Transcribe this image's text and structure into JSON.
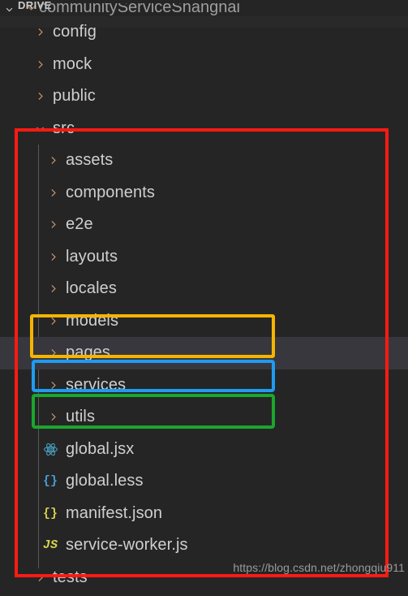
{
  "window": {
    "background": "#252526",
    "selected_row_background": "#37373d"
  },
  "section_header": {
    "title": "DRIVE",
    "twisty": "chevron-down-icon"
  },
  "tree": {
    "root": {
      "label": "communityServiceShanghai",
      "expanded": true
    },
    "items": [
      {
        "label": "config",
        "type": "folder",
        "depth": 1,
        "expanded": false,
        "icon": "chevron-right-icon"
      },
      {
        "label": "mock",
        "type": "folder",
        "depth": 1,
        "expanded": false,
        "icon": "chevron-right-icon"
      },
      {
        "label": "public",
        "type": "folder",
        "depth": 1,
        "expanded": false,
        "icon": "chevron-right-icon"
      },
      {
        "label": "src",
        "type": "folder",
        "depth": 1,
        "expanded": true,
        "icon": "chevron-down-icon"
      },
      {
        "label": "assets",
        "type": "folder",
        "depth": 2,
        "expanded": false,
        "icon": "chevron-right-icon"
      },
      {
        "label": "components",
        "type": "folder",
        "depth": 2,
        "expanded": false,
        "icon": "chevron-right-icon"
      },
      {
        "label": "e2e",
        "type": "folder",
        "depth": 2,
        "expanded": false,
        "icon": "chevron-right-icon"
      },
      {
        "label": "layouts",
        "type": "folder",
        "depth": 2,
        "expanded": false,
        "icon": "chevron-right-icon"
      },
      {
        "label": "locales",
        "type": "folder",
        "depth": 2,
        "expanded": false,
        "icon": "chevron-right-icon"
      },
      {
        "label": "models",
        "type": "folder",
        "depth": 2,
        "expanded": false,
        "icon": "chevron-right-icon",
        "highlight": "orange"
      },
      {
        "label": "pages",
        "type": "folder",
        "depth": 2,
        "expanded": false,
        "icon": "chevron-right-icon",
        "highlight": "blue",
        "selected": true
      },
      {
        "label": "services",
        "type": "folder",
        "depth": 2,
        "expanded": false,
        "icon": "chevron-right-icon",
        "highlight": "green"
      },
      {
        "label": "utils",
        "type": "folder",
        "depth": 2,
        "expanded": false,
        "icon": "chevron-right-icon"
      },
      {
        "label": "global.jsx",
        "type": "file",
        "depth": 2,
        "icon": "react-icon",
        "icon_glyph": "⚛",
        "icon_color": "#4aa3c7"
      },
      {
        "label": "global.less",
        "type": "file",
        "depth": 2,
        "icon": "braces-icon",
        "icon_glyph": "{}",
        "icon_color": "#4a9fd5"
      },
      {
        "label": "manifest.json",
        "type": "file",
        "depth": 2,
        "icon": "braces-icon",
        "icon_glyph": "{}",
        "icon_color": "#d7d34a"
      },
      {
        "label": "service-worker.js",
        "type": "file",
        "depth": 2,
        "icon": "javascript-icon",
        "icon_glyph": "JS",
        "icon_color": "#d7d34a"
      },
      {
        "label": "tests",
        "type": "folder",
        "depth": 1,
        "expanded": false,
        "icon": "chevron-right-icon",
        "clipped": true
      }
    ]
  },
  "annotations": [
    {
      "name": "src-folder-outline",
      "color": "#fc1b12",
      "target": "src"
    },
    {
      "name": "models-folder-outline",
      "color": "#f5b400",
      "target": "models"
    },
    {
      "name": "pages-folder-outline",
      "color": "#1f9bf0",
      "target": "pages"
    },
    {
      "name": "services-folder-outline",
      "color": "#1ba62c",
      "target": "services"
    }
  ],
  "watermark": {
    "text": "https://blog.csdn.net/zhongqiu911"
  }
}
